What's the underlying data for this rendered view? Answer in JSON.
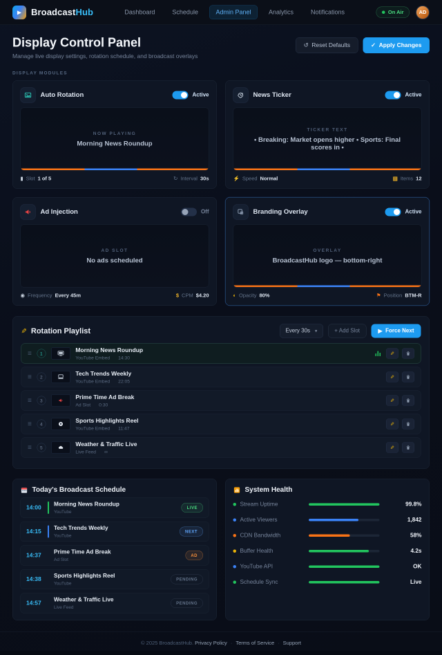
{
  "nav": {
    "brand_primary": "Broadcast",
    "brand_accent": "Hub",
    "items": [
      "Dashboard",
      "Schedule",
      "Admin Panel",
      "Analytics",
      "Notifications"
    ],
    "on_air": "On Air",
    "avatar_initials": "AD"
  },
  "header": {
    "title": "Display Control Panel",
    "subtitle": "Manage live display settings, rotation schedule, and broadcast overlays",
    "reset_icon": "↺",
    "reset_label": "Reset Defaults",
    "apply_icon": "✓",
    "apply_label": "Apply Changes"
  },
  "section_label": "DISPLAY MODULES",
  "modules": [
    {
      "title": "Auto Rotation",
      "toggle_label": "Active",
      "preview_label": "NOW PLAYING",
      "preview_text": "Morning News Roundup",
      "foot": [
        {
          "icon": "▮",
          "label": "Slot",
          "value": "1 of 5"
        },
        {
          "icon": "↻",
          "label": "Interval",
          "value": "30s"
        }
      ]
    },
    {
      "title": "News Ticker",
      "toggle_label": "Active",
      "preview_label": "TICKER TEXT",
      "preview_text": "• Breaking: Market opens higher • Sports: Final scores in •",
      "foot": [
        {
          "icon": "⚡",
          "label": "Speed",
          "value": "Normal"
        },
        {
          "icon": "▤",
          "label": "Items",
          "value": "12"
        }
      ]
    },
    {
      "title": "Ad Injection",
      "toggle_label": "Off",
      "preview_label": "AD SLOT",
      "preview_text": "No ads scheduled",
      "foot": [
        {
          "icon": "◉",
          "label": "Frequency",
          "value": "Every 45m"
        },
        {
          "icon": "$",
          "label": "CPM",
          "value": "$4.20"
        }
      ]
    },
    {
      "title": "Branding Overlay",
      "toggle_label": "Active",
      "preview_label": "OVERLAY",
      "preview_text": "BroadcastHub logo — bottom-right",
      "foot": [
        {
          "icon": "◐",
          "label": "Opacity",
          "value": "80%"
        },
        {
          "icon": "⚑",
          "label": "Position",
          "value": "BTM-R"
        }
      ]
    }
  ],
  "playlist": {
    "title": "Rotation Playlist",
    "interval_value": "Every 30s",
    "chevron": "▾",
    "add_label": "+ Add Slot",
    "force_icon": "▶",
    "force_label": "Force Next",
    "handle_glyph": "≡",
    "edit_glyph": "✎",
    "items": [
      {
        "num": "1",
        "title": "Morning News Roundup",
        "type": "YouTube Embed",
        "duration": "14:30"
      },
      {
        "num": "2",
        "title": "Tech Trends Weekly",
        "type": "YouTube Embed",
        "duration": "22:05"
      },
      {
        "num": "3",
        "title": "Prime Time Ad Break",
        "type": "Ad Slot",
        "duration": "0:30"
      },
      {
        "num": "4",
        "title": "Sports Highlights Reel",
        "type": "YouTube Embed",
        "duration": "11:47"
      },
      {
        "num": "5",
        "title": "Weather & Traffic Live",
        "type": "Live Feed",
        "duration": "∞"
      }
    ]
  },
  "schedule": {
    "title": "Today's Broadcast Schedule",
    "items": [
      {
        "time": "14:00",
        "title": "Morning News Roundup",
        "source": "YouTube",
        "badge": "LIVE"
      },
      {
        "time": "14:15",
        "title": "Tech Trends Weekly",
        "source": "YouTube",
        "badge": "NEXT"
      },
      {
        "time": "14:37",
        "title": "Prime Time Ad Break",
        "source": "Ad Slot",
        "badge": "AD"
      },
      {
        "time": "14:38",
        "title": "Sports Highlights Reel",
        "source": "YouTube",
        "badge": "PENDING"
      },
      {
        "time": "14:57",
        "title": "Weather & Traffic Live",
        "source": "Live Feed",
        "badge": "PENDING"
      }
    ]
  },
  "health": {
    "title": "System Health",
    "metrics": [
      {
        "label": "Stream Uptime",
        "dot": "#22c55e",
        "bar": "#22c55e",
        "pct": 100,
        "value": "99.8%"
      },
      {
        "label": "Active Viewers",
        "dot": "#3b82f6",
        "bar": "#3b82f6",
        "pct": 70,
        "value": "1,842"
      },
      {
        "label": "CDN Bandwidth",
        "dot": "#f97316",
        "bar": "#f97316",
        "pct": 58,
        "value": "58%"
      },
      {
        "label": "Buffer Health",
        "dot": "#eab308",
        "bar": "#22c55e",
        "pct": 85,
        "value": "4.2s"
      },
      {
        "label": "YouTube API",
        "dot": "#3b82f6",
        "bar": "#22c55e",
        "pct": 100,
        "value": "OK"
      },
      {
        "label": "Schedule Sync",
        "dot": "#22c55e",
        "bar": "#22c55e",
        "pct": 100,
        "value": "Live"
      }
    ]
  },
  "footer": {
    "copyright": "© 2025 BroadcastHub.",
    "links": [
      "Privacy Policy",
      "Terms of Service",
      "Support"
    ],
    "sep": "·"
  },
  "colors": {
    "accent_blue": "#1d9bf0",
    "accent_orange": "#f97316",
    "live_green": "#22c55e"
  }
}
